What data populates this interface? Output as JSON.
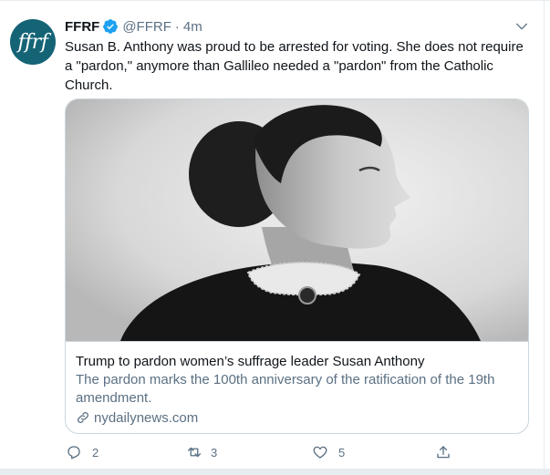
{
  "tweet": {
    "avatar_text": "ffrf",
    "display_name": "FFRF",
    "handle": "@FFRF",
    "separator": "·",
    "time": "4m",
    "text": "Susan B. Anthony was proud to be arrested for voting. She does not require a \"pardon,\" anymore than Gallileo needed a \"pardon\" from the Catholic Church.",
    "colors": {
      "avatar_bg": "#156476",
      "verified": "#1da1f2",
      "secondary_text": "#5b7083"
    }
  },
  "card": {
    "image_description_icon": "portrait-photo",
    "title": "Trump to pardon women’s suffrage leader Susan Anthony",
    "description": "The pardon marks the 100th anniversary of the ratification of the 19th amendment.",
    "domain": "nydailynews.com",
    "link_icon": "link-icon"
  },
  "actions": {
    "reply": {
      "icon": "reply-icon",
      "count": "2"
    },
    "retweet": {
      "icon": "retweet-icon",
      "count": "3"
    },
    "like": {
      "icon": "heart-icon",
      "count": "5"
    },
    "share": {
      "icon": "share-icon"
    }
  }
}
